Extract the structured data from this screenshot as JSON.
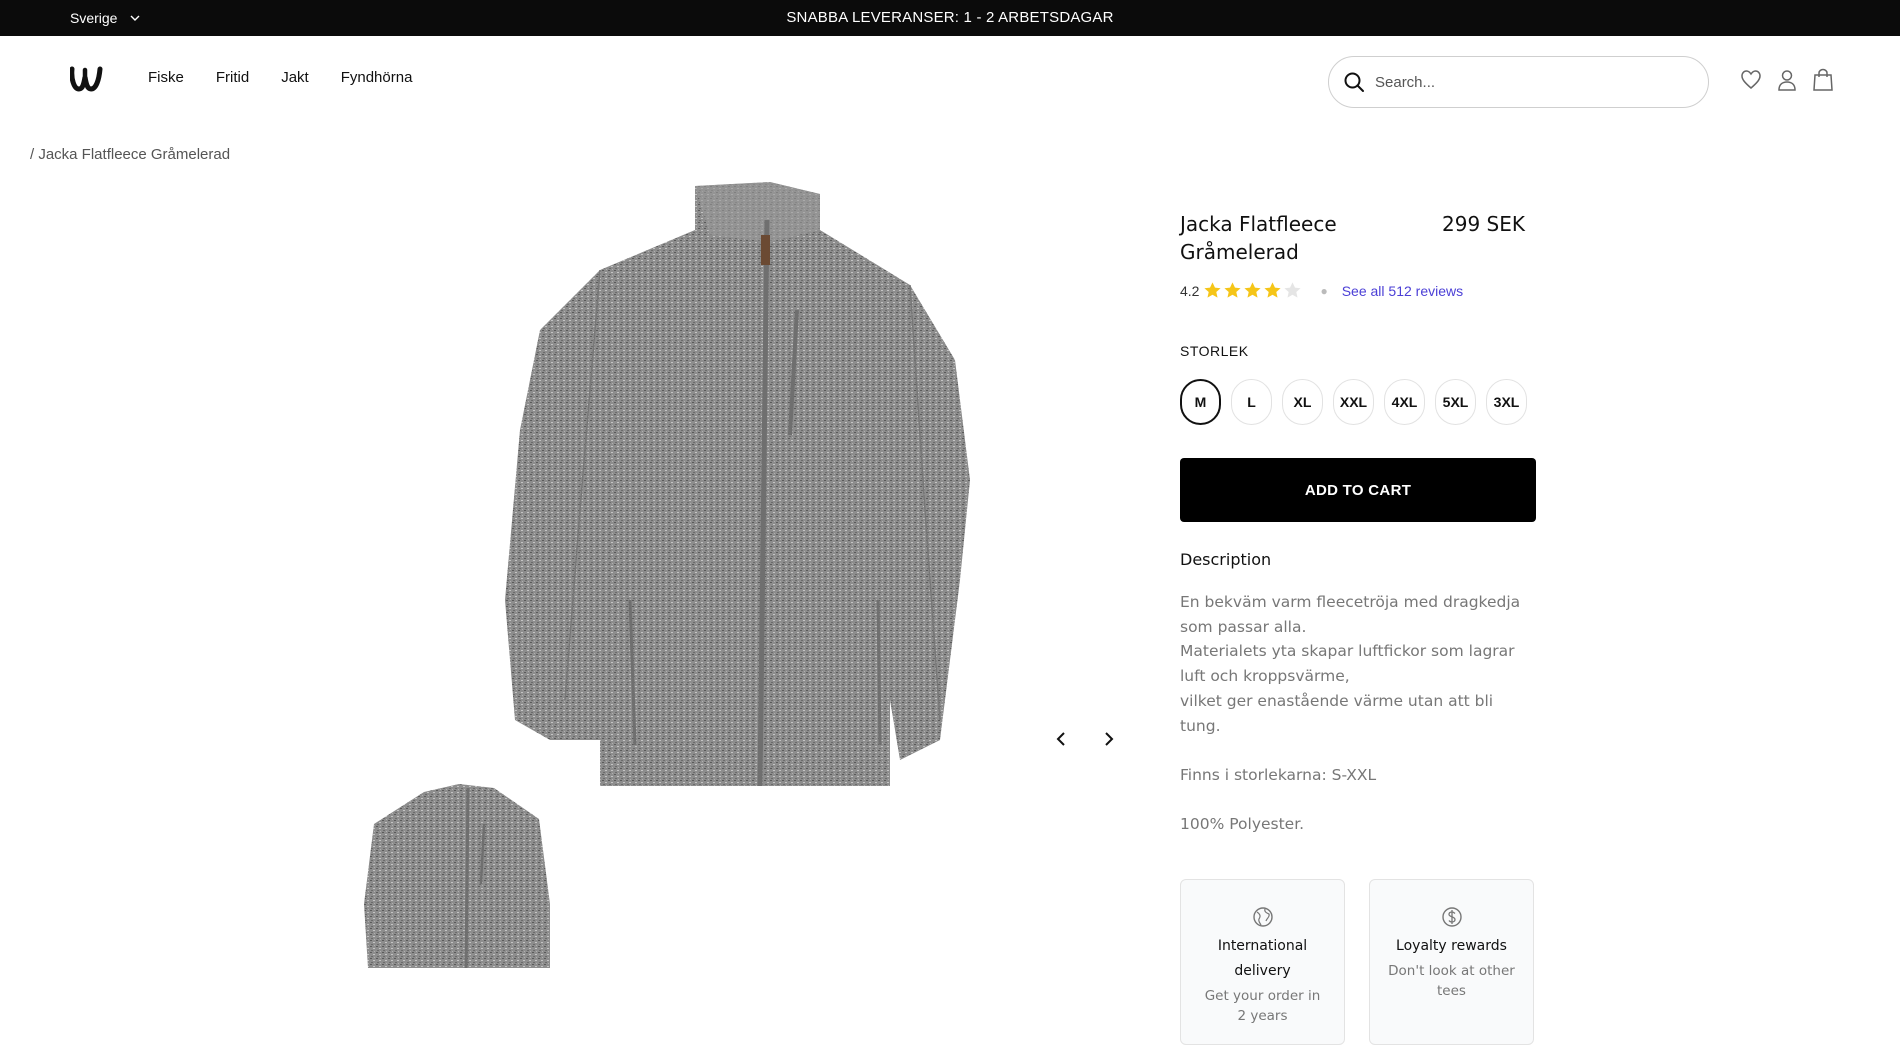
{
  "topbar": {
    "country": "Sverige",
    "announcement": "SNABBA LEVERANSER: 1 - 2 ARBETSDAGAR"
  },
  "header": {
    "nav": [
      "Fiske",
      "Fritid",
      "Jakt",
      "Fyndhörna"
    ],
    "search_placeholder": "Search...",
    "icons": [
      "heart-icon",
      "user-icon",
      "bag-icon"
    ]
  },
  "breadcrumb": "/ Jacka Flatfleece Gråmelerad",
  "gallery": {
    "image_count": 2,
    "prev_icon": "chevron-left-icon",
    "next_icon": "chevron-right-icon"
  },
  "product": {
    "title": "Jacka Flatfleece Gråmelerad",
    "price": "299 SEK",
    "rating": "4.2",
    "stars_filled": 4,
    "stars_total": 5,
    "reviews_link": "See all 512 reviews",
    "size_label": "STORLEK",
    "sizes": [
      "M",
      "L",
      "XL",
      "XXL",
      "4XL",
      "5XL",
      "3XL"
    ],
    "selected_size": "M",
    "add_to_cart": "ADD TO CART"
  },
  "description": {
    "heading": "Description",
    "lines": [
      "En bekväm varm fleecetröja med dragkedja som passar alla.",
      "Materialets yta skapar luftfickor som lagrar luft och kroppsvärme,",
      "vilket ger enastående värme utan att bli tung.",
      "Finns i storlekarna: S-XXL",
      "100% Polyester."
    ]
  },
  "perks": [
    {
      "icon": "globe-icon",
      "title": "International delivery",
      "text": "Get your order in 2 years"
    },
    {
      "icon": "dollar-icon",
      "title": "Loyalty rewards",
      "text": "Don't look at other tees"
    }
  ],
  "colors": {
    "topbar": "#0b0b0b",
    "star": "#f5c518",
    "link": "#4b3fd6",
    "button": "#000000"
  }
}
